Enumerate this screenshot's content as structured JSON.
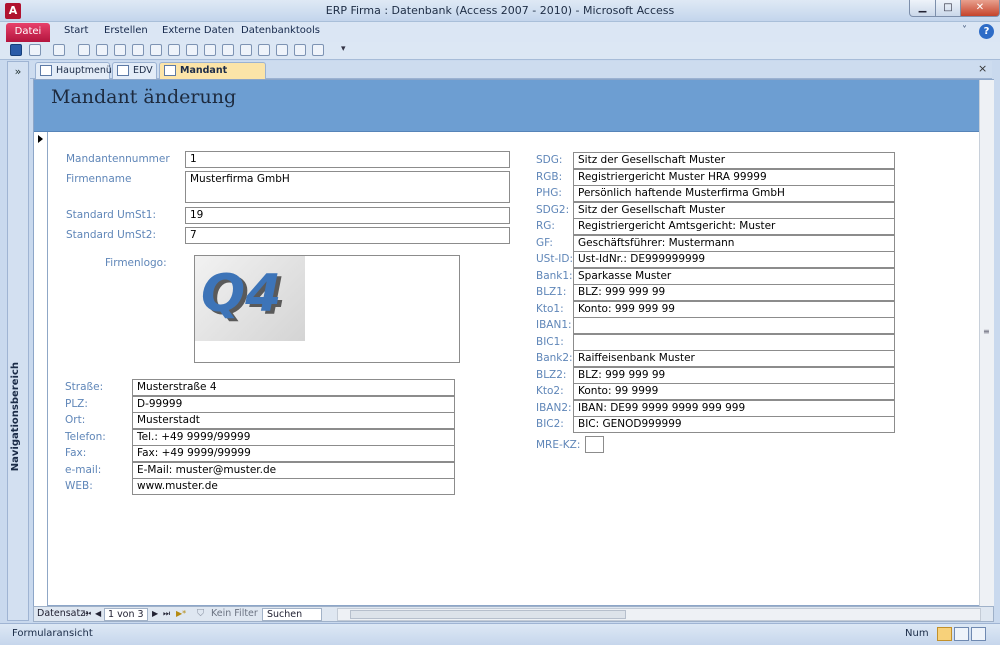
{
  "window": {
    "title": "ERP Firma : Datenbank (Access 2007 - 2010)  -  Microsoft Access",
    "app_icon": "A"
  },
  "ribbon": {
    "tabs": [
      {
        "label": "Datei"
      },
      {
        "label": "Start"
      },
      {
        "label": "Erstellen"
      },
      {
        "label": "Externe Daten"
      },
      {
        "label": "Datenbanktools"
      }
    ],
    "help": "?"
  },
  "nav_pane": {
    "toggle": "»",
    "label": "Navigationsbereich"
  },
  "doc_tabs": [
    {
      "label": "Hauptmenü"
    },
    {
      "label": "EDV"
    },
    {
      "label": "Mandant änderung",
      "active": true
    }
  ],
  "doc_close": "×",
  "form": {
    "title": "Mandant änderung",
    "left_top": {
      "mandantennummer": {
        "label": "Mandantennummer",
        "value": "1"
      },
      "firmenname": {
        "label": "Firmenname",
        "value": "Musterfirma GmbH"
      },
      "umst1": {
        "label": "Standard UmSt1:",
        "value": "19"
      },
      "umst2": {
        "label": "Standard UmSt2:",
        "value": "7"
      },
      "firmenlogo": {
        "label": "Firmenlogo:",
        "logo_text": "Q4"
      }
    },
    "address": [
      {
        "label": "Straße:",
        "value": "Musterstraße 4"
      },
      {
        "label": "PLZ:",
        "value": "D-99999"
      },
      {
        "label": "Ort:",
        "value": "Musterstadt"
      },
      {
        "label": "Telefon:",
        "value": "Tel.: +49 9999/99999"
      },
      {
        "label": "Fax:",
        "value": "Fax: +49 9999/99999"
      },
      {
        "label": "e-mail:",
        "value": "E-Mail: muster@muster.de"
      },
      {
        "label": "WEB:",
        "value": "www.muster.de"
      }
    ],
    "right": [
      {
        "label": "SDG:",
        "value": "Sitz der Gesellschaft Muster"
      },
      {
        "label": "RGB:",
        "value": "Registriergericht Muster HRA 99999"
      },
      {
        "label": "PHG:",
        "value": "Persönlich haftende Musterfirma GmbH"
      },
      {
        "label": "SDG2:",
        "value": "Sitz der Gesellschaft Muster"
      },
      {
        "label": "RG:",
        "value": "Registriergericht Amtsgericht: Muster"
      },
      {
        "label": "GF:",
        "value": "Geschäftsführer: Mustermann"
      },
      {
        "label": "USt-ID:",
        "value": "Ust-IdNr.: DE999999999"
      },
      {
        "label": "Bank1:",
        "value": "Sparkasse Muster"
      },
      {
        "label": "BLZ1:",
        "value": "BLZ: 999 999 99"
      },
      {
        "label": "Kto1:",
        "value": "Konto: 999 999 99"
      },
      {
        "label": "IBAN1:",
        "value": ""
      },
      {
        "label": "BIC1:",
        "value": ""
      },
      {
        "label": "Bank2:",
        "value": "Raiffeisenbank Muster"
      },
      {
        "label": "BLZ2:",
        "value": "BLZ: 999 999 99"
      },
      {
        "label": "Kto2:",
        "value": "Konto: 99 9999"
      },
      {
        "label": "IBAN2:",
        "value": "IBAN: DE99 9999 9999 999 999"
      },
      {
        "label": "BIC2:",
        "value": "BIC: GENOD999999"
      }
    ],
    "mre_kz": {
      "label": "MRE-KZ:",
      "checked": false
    }
  },
  "record_nav": {
    "label": "Datensatz:",
    "first": "⏮",
    "prev": "◀",
    "current": "1 von 3",
    "next": "▶",
    "last": "⏭",
    "new": "▶*",
    "filter": "Kein Filter",
    "search": "Suchen"
  },
  "status": {
    "text": "Formularansicht",
    "num": "Num"
  }
}
